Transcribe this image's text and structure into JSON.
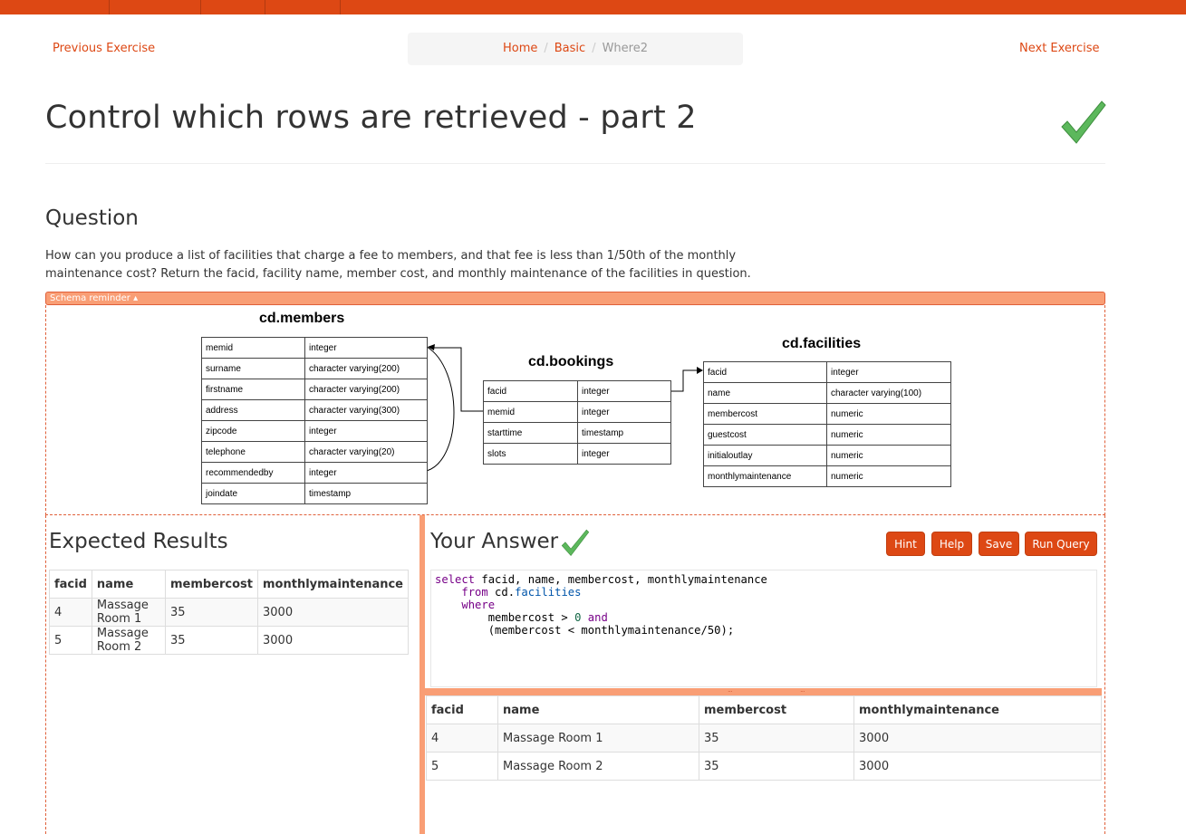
{
  "nav": {
    "previous_label": "Previous Exercise",
    "next_label": "Next Exercise",
    "breadcrumb": {
      "home": "Home",
      "section": "Basic",
      "current": "Where2",
      "separator": "/"
    }
  },
  "page": {
    "title": "Control which rows are retrieved - part 2"
  },
  "question": {
    "heading": "Question",
    "text": "How can you produce a list of facilities that charge a fee to members, and that fee is less than 1/50th of the monthly maintenance cost? Return the facid, facility name, member cost, and monthly maintenance of the facilities in question."
  },
  "schema": {
    "toggle_label": "Schema reminder ▴",
    "tables": [
      {
        "title": "cd.members",
        "rows": [
          [
            "memid",
            "integer"
          ],
          [
            "surname",
            "character varying(200)"
          ],
          [
            "firstname",
            "character varying(200)"
          ],
          [
            "address",
            "character varying(300)"
          ],
          [
            "zipcode",
            "integer"
          ],
          [
            "telephone",
            "character varying(20)"
          ],
          [
            "recommendedby",
            "integer"
          ],
          [
            "joindate",
            "timestamp"
          ]
        ]
      },
      {
        "title": "cd.bookings",
        "rows": [
          [
            "facid",
            "integer"
          ],
          [
            "memid",
            "integer"
          ],
          [
            "starttime",
            "timestamp"
          ],
          [
            "slots",
            "integer"
          ]
        ]
      },
      {
        "title": "cd.facilities",
        "rows": [
          [
            "facid",
            "integer"
          ],
          [
            "name",
            "character varying(100)"
          ],
          [
            "membercost",
            "numeric"
          ],
          [
            "guestcost",
            "numeric"
          ],
          [
            "initialoutlay",
            "numeric"
          ],
          [
            "monthlymaintenance",
            "numeric"
          ]
        ]
      }
    ]
  },
  "expected": {
    "heading": "Expected Results",
    "columns": [
      "facid",
      "name",
      "membercost",
      "monthlymaintenance"
    ],
    "rows": [
      [
        "4",
        "Massage Room 1",
        "35",
        "3000"
      ],
      [
        "5",
        "Massage Room 2",
        "35",
        "3000"
      ]
    ]
  },
  "answer": {
    "heading": "Your Answer",
    "buttons": {
      "hint": "Hint",
      "help": "Help",
      "save": "Save",
      "run": "Run Query"
    },
    "query_lines": [
      "select facid, name, membercost, monthlymaintenance",
      "    from cd.facilities",
      "    where",
      "        membercost > 0 and",
      "        (membercost < monthlymaintenance/50);"
    ],
    "result_columns": [
      "facid",
      "name",
      "membercost",
      "monthlymaintenance"
    ],
    "result_rows": [
      [
        "4",
        "Massage Room 1",
        "35",
        "3000"
      ],
      [
        "5",
        "Massage Room 2",
        "35",
        "3000"
      ]
    ]
  },
  "colors": {
    "accent": "#dd4814",
    "accent_light": "#f99e75",
    "check_green": "#5cb85c"
  }
}
